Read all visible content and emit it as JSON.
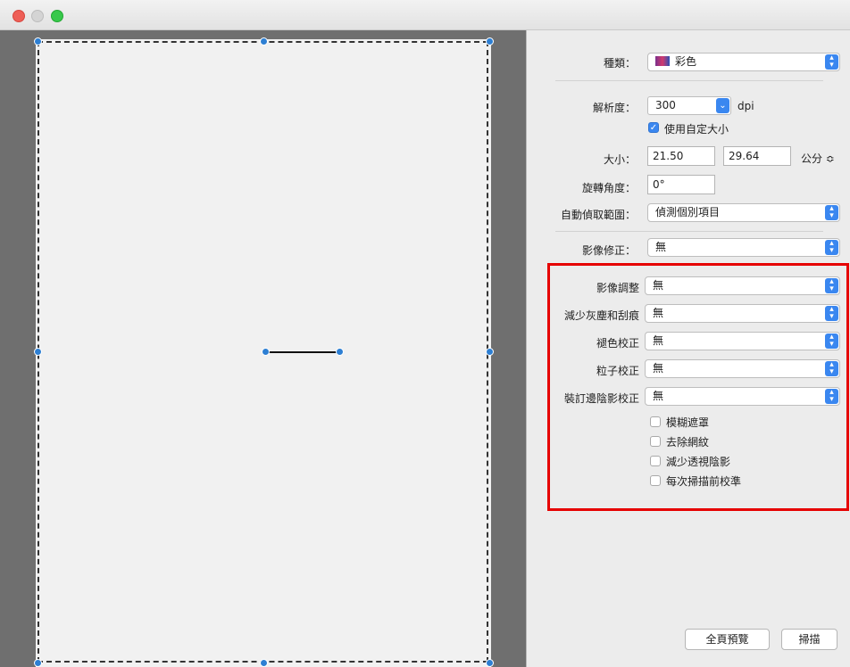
{
  "window": {
    "controls": [
      "close-control",
      "minimize-control",
      "zoom-control"
    ]
  },
  "settings": {
    "type": {
      "label": "種類：",
      "value": "彩色",
      "icon": "color-swatch-icon"
    },
    "resolution": {
      "label": "解析度：",
      "value": "300",
      "unit": "dpi"
    },
    "custom_size": {
      "label": "使用自定大小",
      "checked": true
    },
    "size": {
      "label": "大小：",
      "width": "21.50",
      "height": "29.64",
      "unit": "公分 ≎"
    },
    "rotation": {
      "label": "旋轉角度：",
      "value": "0°"
    },
    "auto_crop": {
      "label": "自動偵取範圍：",
      "value": "偵測個別項目"
    },
    "image_correction": {
      "label": "影像修正：",
      "value": "無"
    }
  },
  "adjustments": {
    "image_adjust": {
      "label": "影像調整",
      "value": "無"
    },
    "dust_scratch": {
      "label": "減少灰塵和刮痕",
      "value": "無"
    },
    "fading": {
      "label": "褪色校正",
      "value": "無"
    },
    "grain": {
      "label": "粒子校正",
      "value": "無"
    },
    "gutter_shadow": {
      "label": "裝訂邊陰影校正",
      "value": "無"
    },
    "checkboxes": [
      {
        "label": "模糊遮罩",
        "checked": false
      },
      {
        "label": "去除網紋",
        "checked": false
      },
      {
        "label": "減少透視陰影",
        "checked": false
      },
      {
        "label": "每次掃描前校準",
        "checked": false
      }
    ],
    "highlight_color": "#e60000"
  },
  "buttons": {
    "overview": "全頁預覽",
    "scan": "掃描"
  },
  "colors": {
    "accent": "#3a87f0",
    "handle": "#2d7fd3",
    "preview_bg": "#6f6f6f"
  }
}
